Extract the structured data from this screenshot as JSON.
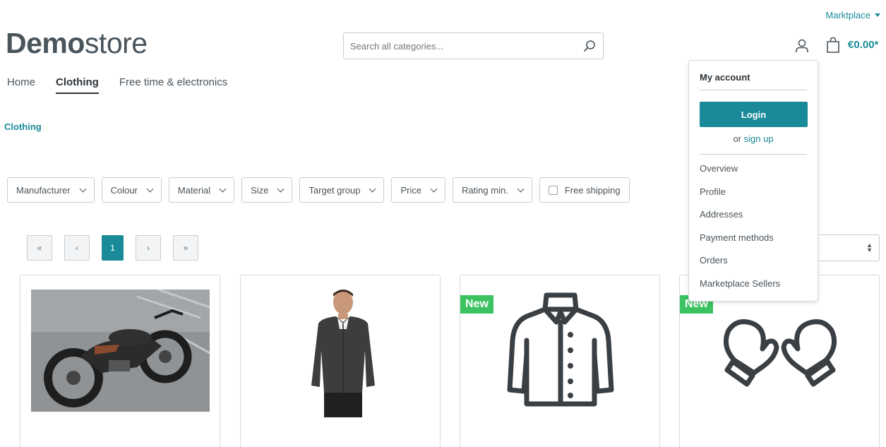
{
  "header": {
    "marketplace_label": "Marktplace",
    "logo_bold": "Demo",
    "logo_light": "store",
    "search_placeholder": "Search all categories...",
    "cart_total": "€0.00*"
  },
  "nav": {
    "items": [
      "Home",
      "Clothing",
      "Free time & electronics"
    ],
    "active": "Clothing"
  },
  "breadcrumb": "Clothing",
  "filters": [
    "Manufacturer",
    "Colour",
    "Material",
    "Size",
    "Target group",
    "Price",
    "Rating min."
  ],
  "free_shipping_label": "Free shipping",
  "pagination": {
    "first": "«",
    "prev": "‹",
    "current": "1",
    "next": "›",
    "last": "»"
  },
  "products": [
    {
      "image": "motorcycle-photo",
      "badge": ""
    },
    {
      "image": "man-in-fleece-jacket-photo",
      "badge": ""
    },
    {
      "image": "jacket-icon",
      "badge": "New"
    },
    {
      "image": "mittens-icon",
      "badge": "New"
    }
  ],
  "account_dropdown": {
    "title": "My account",
    "login_label": "Login",
    "or_text": "or",
    "signup_label": "sign up",
    "links": [
      "Overview",
      "Profile",
      "Addresses",
      "Payment methods",
      "Orders",
      "Marketplace Sellers"
    ]
  },
  "colors": {
    "accent": "#1a8a99",
    "badge_green": "#3cc261",
    "text": "#4a545b"
  }
}
